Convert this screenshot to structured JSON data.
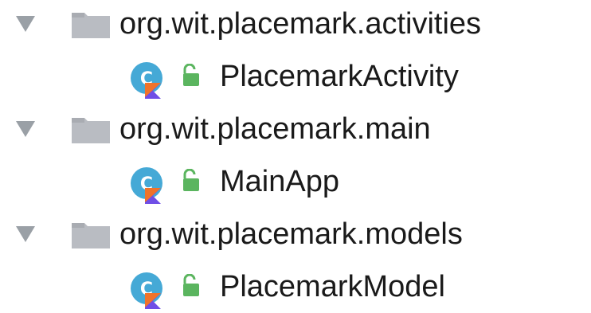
{
  "tree": {
    "items": [
      {
        "type": "package",
        "label": "org.wit.placemark.activities",
        "expanded": true,
        "icon": "folder-icon"
      },
      {
        "type": "class",
        "label": "PlacemarkActivity",
        "icon": "kotlin-class-icon",
        "visibility_icon": "public-lock-icon"
      },
      {
        "type": "package",
        "label": "org.wit.placemark.main",
        "expanded": true,
        "icon": "folder-icon"
      },
      {
        "type": "class",
        "label": "MainApp",
        "icon": "kotlin-class-icon",
        "visibility_icon": "public-lock-icon"
      },
      {
        "type": "package",
        "label": "org.wit.placemark.models",
        "expanded": true,
        "icon": "folder-icon"
      },
      {
        "type": "class",
        "label": "PlacemarkModel",
        "icon": "kotlin-class-icon",
        "visibility_icon": "public-lock-icon"
      }
    ]
  },
  "colors": {
    "folder": "#b9bcc2",
    "class_circle": "#45a9d6",
    "kotlin_orange": "#f0732a",
    "kotlin_purple": "#6f4ee6",
    "lock_green": "#5bb55f",
    "toggle": "#9aa0a6"
  }
}
